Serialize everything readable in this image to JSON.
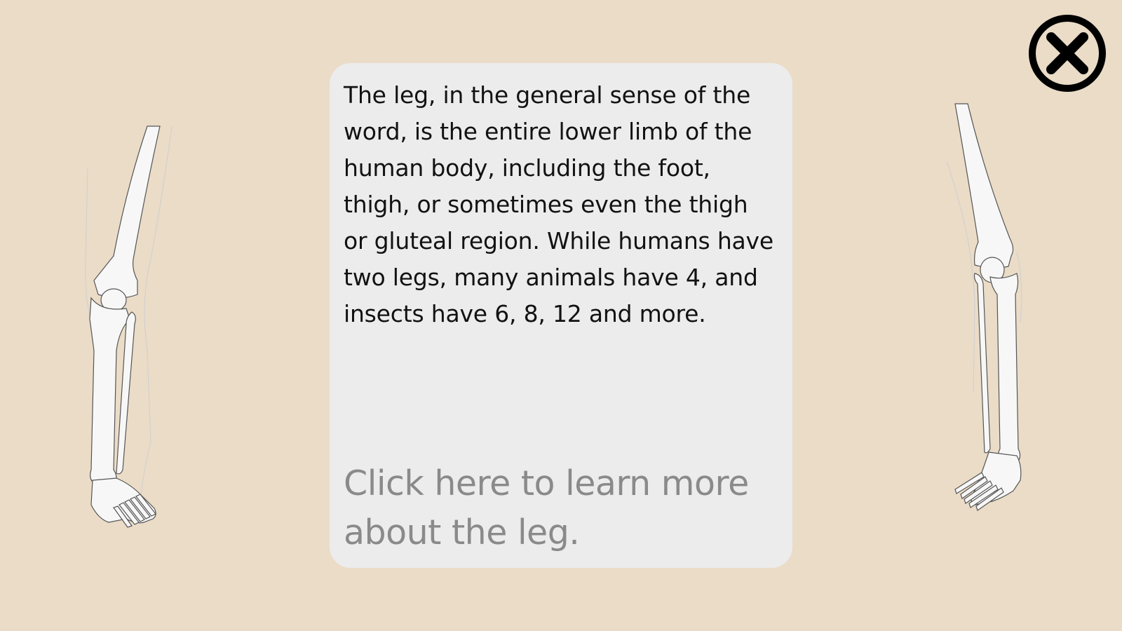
{
  "info_card": {
    "description": "The leg, in the general sense of the word, is the entire lower limb of the human body, including the foot, thigh, or sometimes even the thigh or gluteal region. While humans have two legs, many animals have 4, and insects have 6, 8, 12 and more.",
    "link_text": "Click here to learn more about the leg."
  },
  "close_button": {
    "icon": "close-icon"
  },
  "colors": {
    "background": "#eadcc7",
    "card": "#ececec",
    "text": "#121212",
    "link": "#8a8a8a"
  }
}
